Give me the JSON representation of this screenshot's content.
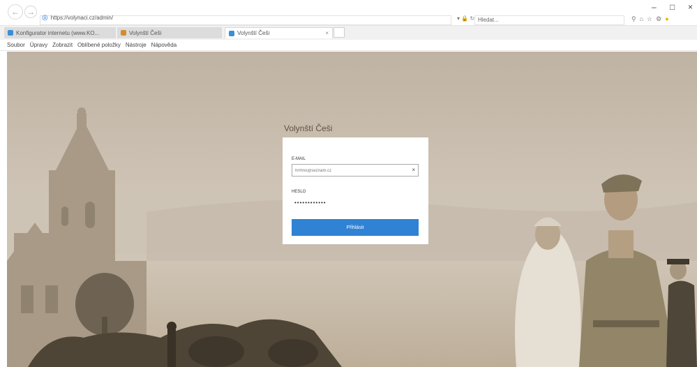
{
  "browser": {
    "url": "https://volynaci.cz/admin/",
    "search_placeholder": "Hledat...",
    "tabs": [
      {
        "label": "Konfigurator internetu (www.KO..."
      },
      {
        "label": "Volynští Češi"
      },
      {
        "label": "Volynští Češi"
      }
    ],
    "menu": [
      "Soubor",
      "Úpravy",
      "Zobrazit",
      "Oblíbené položky",
      "Nástroje",
      "Nápověda"
    ]
  },
  "login": {
    "site_title": "Volynští Češi",
    "email_label": "E-MAIL",
    "email_value": "hrrhno@seznam.cz",
    "password_label": "HESLO",
    "password_value": "••••••••••••",
    "submit_label": "Přihlásit"
  },
  "colors": {
    "accent": "#2f82d4",
    "sepia_background": "#c9beb0"
  }
}
